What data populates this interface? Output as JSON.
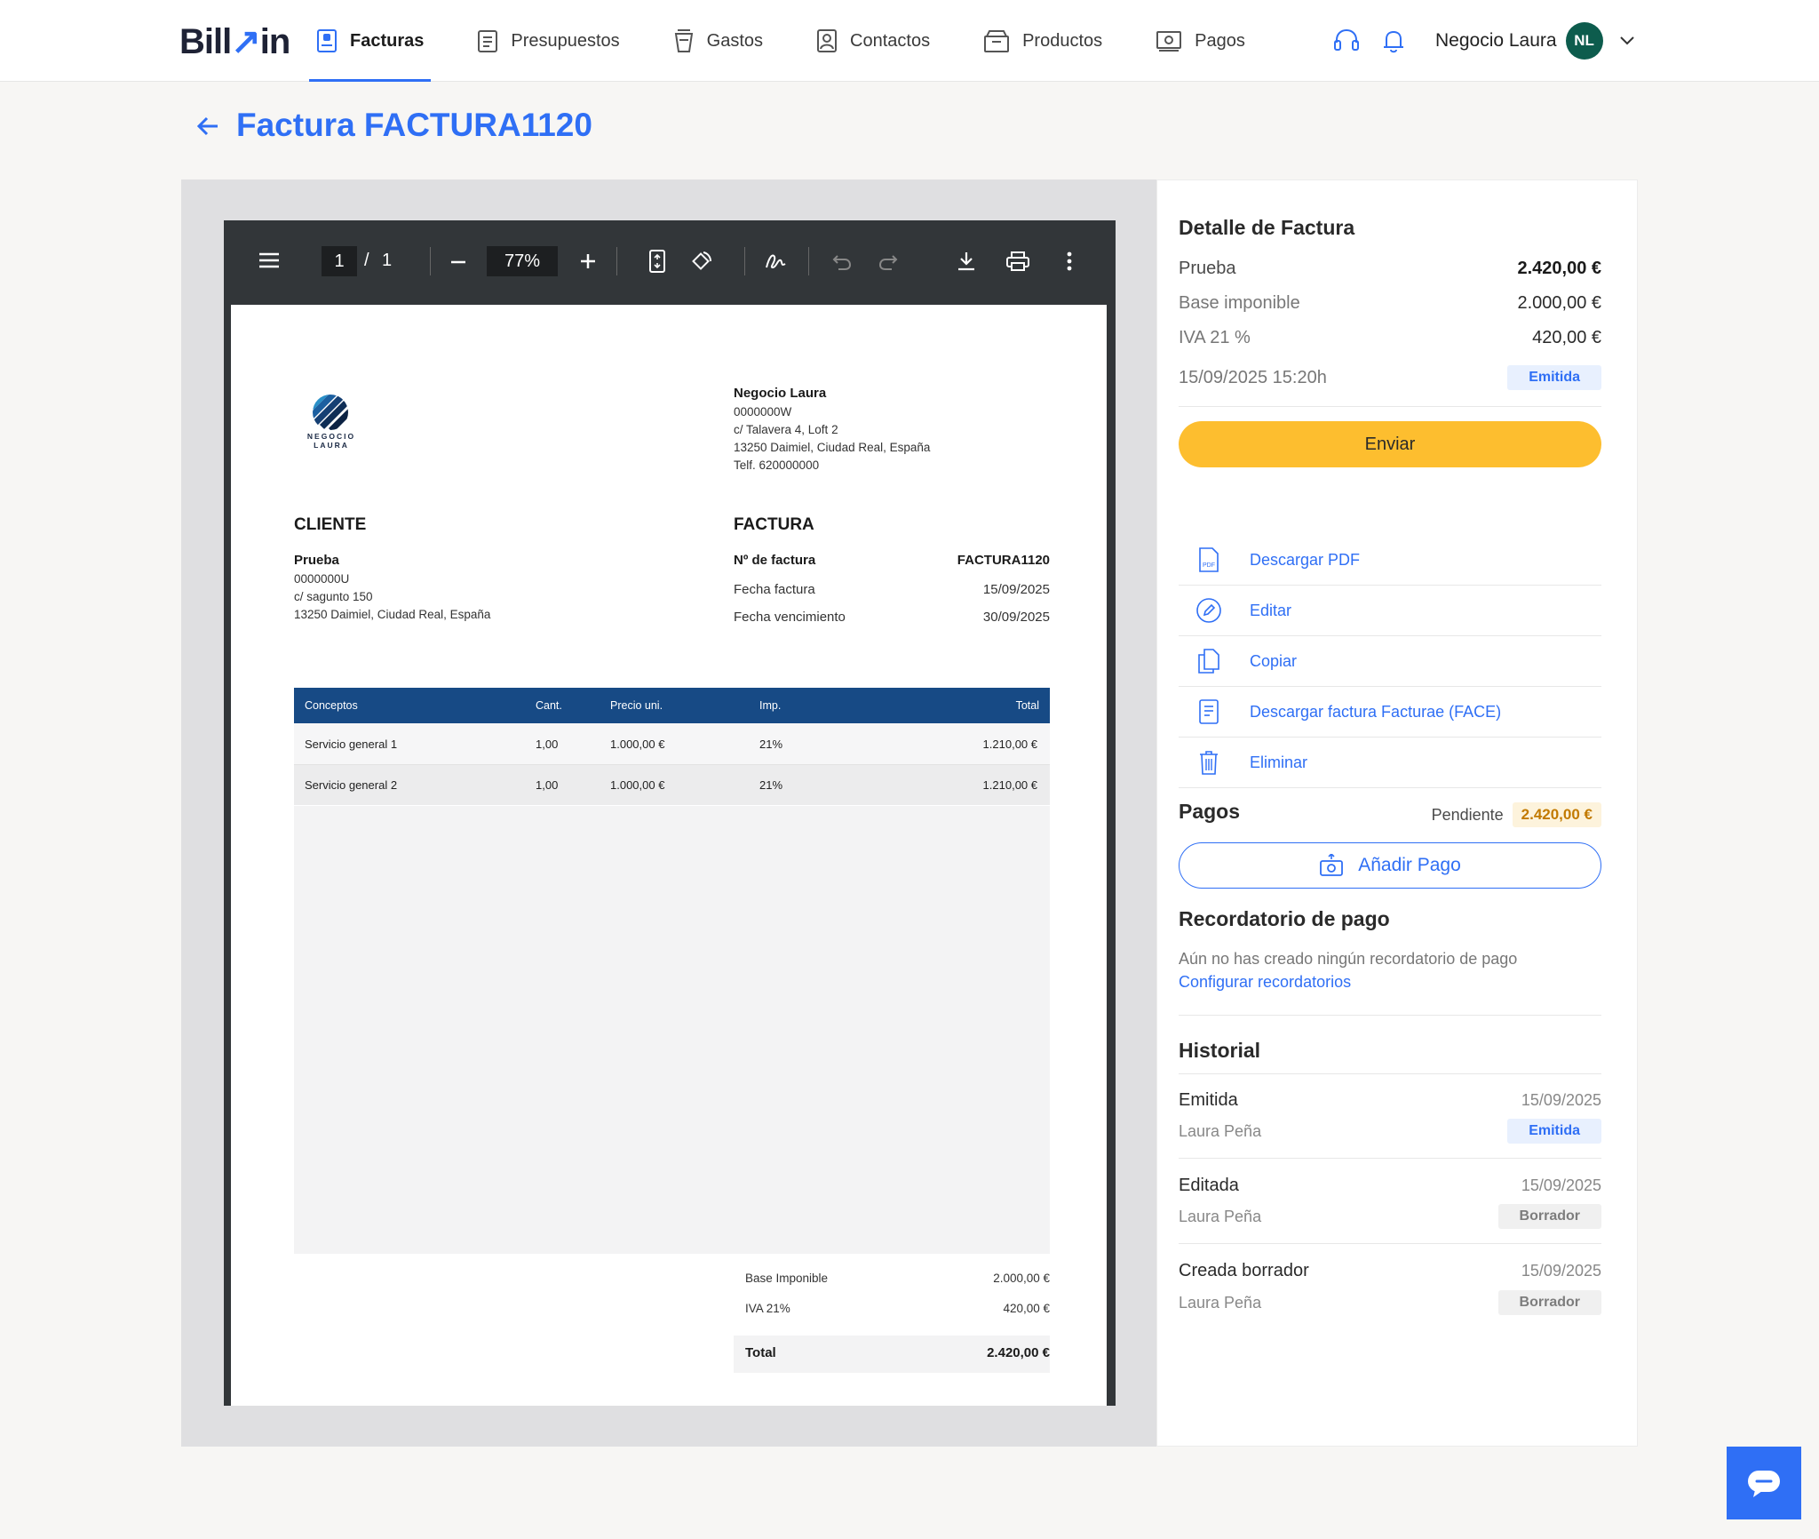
{
  "header": {
    "logo_text": "Billin",
    "nav": [
      {
        "label": "Facturas",
        "icon": "invoice-icon",
        "active": true
      },
      {
        "label": "Presupuestos",
        "icon": "clipboard-icon"
      },
      {
        "label": "Gastos",
        "icon": "cup-icon"
      },
      {
        "label": "Contactos",
        "icon": "contact-card-icon"
      },
      {
        "label": "Productos",
        "icon": "box-icon"
      },
      {
        "label": "Pagos",
        "icon": "cash-icon"
      }
    ],
    "account_name": "Negocio Laura",
    "avatar_initials": "NL",
    "colors": {
      "accent": "#2f6ff5",
      "avatar": "#0d5c4d"
    }
  },
  "page": {
    "title": "Factura FACTURA1120"
  },
  "pdf_toolbar": {
    "page_current": "1",
    "page_separator": "/",
    "page_total": "1",
    "zoom": "77%"
  },
  "invoice": {
    "logo_line1": "NEGOCIO",
    "logo_line2": "LAURA",
    "issuer": {
      "name": "Negocio Laura",
      "nif": "0000000W",
      "address1": "c/ Talavera 4, Loft 2",
      "address2": "13250 Daimiel, Ciudad Real, España",
      "phone": "Telf. 620000000"
    },
    "client_heading": "CLIENTE",
    "client": {
      "name": "Prueba",
      "nif": "0000000U",
      "address1": "c/ sagunto 150",
      "address2": "13250 Daimiel, Ciudad Real, España"
    },
    "invoice_heading": "FACTURA",
    "number_label": "Nº de factura",
    "number": "FACTURA1120",
    "date_label": "Fecha factura",
    "date": "15/09/2025",
    "due_label": "Fecha vencimiento",
    "due": "30/09/2025",
    "table_headers": [
      "Conceptos",
      "Cant.",
      "Precio uni.",
      "Imp.",
      "Total"
    ],
    "rows": [
      [
        "Servicio general 1",
        "1,00",
        "1.000,00 €",
        "21%",
        "1.210,00 €"
      ],
      [
        "Servicio general 2",
        "1,00",
        "1.000,00 €",
        "21%",
        "1.210,00 €"
      ]
    ],
    "base_label": "Base Imponible",
    "base": "2.000,00 €",
    "iva_label": "IVA 21%",
    "iva": "420,00 €",
    "total_label": "Total",
    "total": "2.420,00 €"
  },
  "side": {
    "detail_heading": "Detalle de Factura",
    "client_name": "Prueba",
    "client_total": "2.420,00 €",
    "base_label": "Base imponible",
    "base": "2.000,00 €",
    "iva_label": "IVA 21 %",
    "iva": "420,00 €",
    "datetime": "15/09/2025 15:20h",
    "status": "Emitida",
    "send_label": "Enviar",
    "actions": [
      {
        "label": "Descargar PDF",
        "icon": "pdf-file-icon"
      },
      {
        "label": "Editar",
        "icon": "edit-pencil-icon"
      },
      {
        "label": "Copiar",
        "icon": "copy-icon"
      },
      {
        "label": "Descargar factura Facturae (FACE)",
        "icon": "facturae-doc-icon"
      },
      {
        "label": "Eliminar",
        "icon": "trash-icon"
      }
    ],
    "payments_heading": "Pagos",
    "pending_label": "Pendiente",
    "pending_amount": "2.420,00 €",
    "add_payment_label": "Añadir Pago",
    "reminder_heading": "Recordatorio de pago",
    "reminder_text": "Aún no has creado ningún recordatorio de pago",
    "reminder_link": "Configurar recordatorios",
    "history_heading": "Historial",
    "history": [
      {
        "event": "Emitida",
        "date": "15/09/2025",
        "user": "Laura Peña",
        "badge": "Emitida"
      },
      {
        "event": "Editada",
        "date": "15/09/2025",
        "user": "Laura Peña",
        "badge": "Borrador"
      },
      {
        "event": "Creada borrador",
        "date": "15/09/2025",
        "user": "Laura Peña",
        "badge": "Borrador"
      }
    ]
  }
}
